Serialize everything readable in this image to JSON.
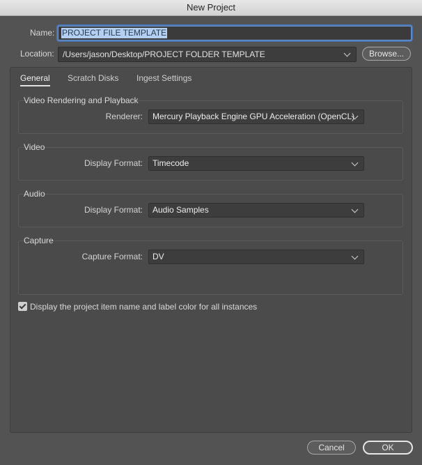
{
  "window": {
    "title": "New Project"
  },
  "name": {
    "label": "Name:",
    "value": "PROJECT FILE TEMPLATE"
  },
  "location": {
    "label": "Location:",
    "value": "/Users/jason/Desktop/PROJECT FOLDER TEMPLATE",
    "browse_label": "Browse..."
  },
  "tabs": [
    {
      "label": "General",
      "active": true
    },
    {
      "label": "Scratch Disks",
      "active": false
    },
    {
      "label": "Ingest Settings",
      "active": false
    }
  ],
  "groups": {
    "rendering": {
      "title": "Video Rendering and Playback",
      "field_label": "Renderer:",
      "value": "Mercury Playback Engine GPU Acceleration (OpenCL)"
    },
    "video": {
      "title": "Video",
      "field_label": "Display Format:",
      "value": "Timecode"
    },
    "audio": {
      "title": "Audio",
      "field_label": "Display Format:",
      "value": "Audio Samples"
    },
    "capture": {
      "title": "Capture",
      "field_label": "Capture Format:",
      "value": "DV"
    }
  },
  "checkbox": {
    "label": "Display the project item name and label color for all instances",
    "checked": true
  },
  "footer": {
    "cancel_label": "Cancel",
    "ok_label": "OK"
  }
}
